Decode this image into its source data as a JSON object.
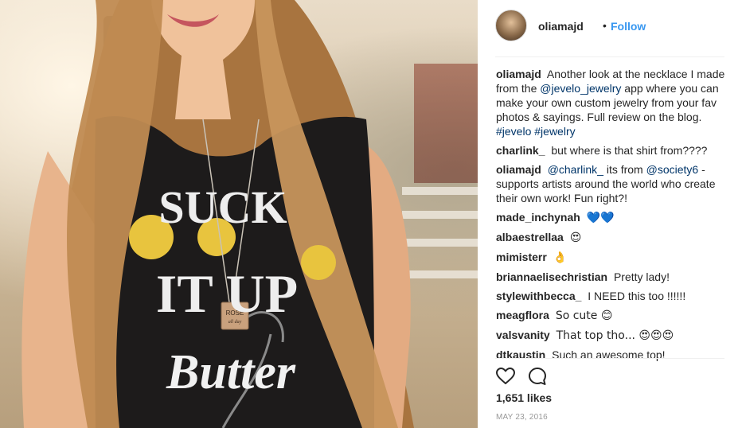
{
  "post": {
    "username": "oliamajd",
    "dot": "•",
    "follow_label": "Follow",
    "caption": {
      "user": "oliamajd",
      "text1": "Another look at the necklace I made from the",
      "mention": "@jevelo_jewelry",
      "text2": "app where you can make your own custom jewelry from your fav photos & sayings. Full review on the blog.",
      "tag1": "#jevelo",
      "tag2": "#jewelry"
    },
    "comments": [
      {
        "user": "charlink_",
        "text": "but where is that shirt from????"
      },
      {
        "user": "oliamajd",
        "mention1": "@charlink_",
        "text1": "its from",
        "mention2": "@society6",
        "text2": "- supports artists around the world who create their own work! Fun right?!"
      },
      {
        "user": "made_inchynah",
        "text": "💙💙"
      },
      {
        "user": "albaestrellaa",
        "text": "😍"
      },
      {
        "user": "mimisterr",
        "text": "👌"
      },
      {
        "user": "briannaelisechristian",
        "text": "Pretty lady!"
      },
      {
        "user": "stylewithbecca_",
        "text": "I NEED this too !!!!!!"
      },
      {
        "user": "meagflora",
        "text": "So cute 😊"
      },
      {
        "user": "valsvanity",
        "text": "That top tho... 😍😍😍"
      },
      {
        "user": "dtkaustin",
        "text": "Such an awesome top!"
      }
    ],
    "likes": "1,651 likes",
    "date": "MAY 23, 2016"
  },
  "photo": {
    "necklace_text1": "ROSÉ",
    "necklace_text2": "all day",
    "shirt_line1": "SUCK",
    "shirt_line2": "IT UP",
    "shirt_line3": "Butter"
  },
  "icons": [
    "heart-icon",
    "comment-icon"
  ],
  "colors": {
    "link": "#003569",
    "follow": "#3897f0",
    "date": "#999999"
  }
}
